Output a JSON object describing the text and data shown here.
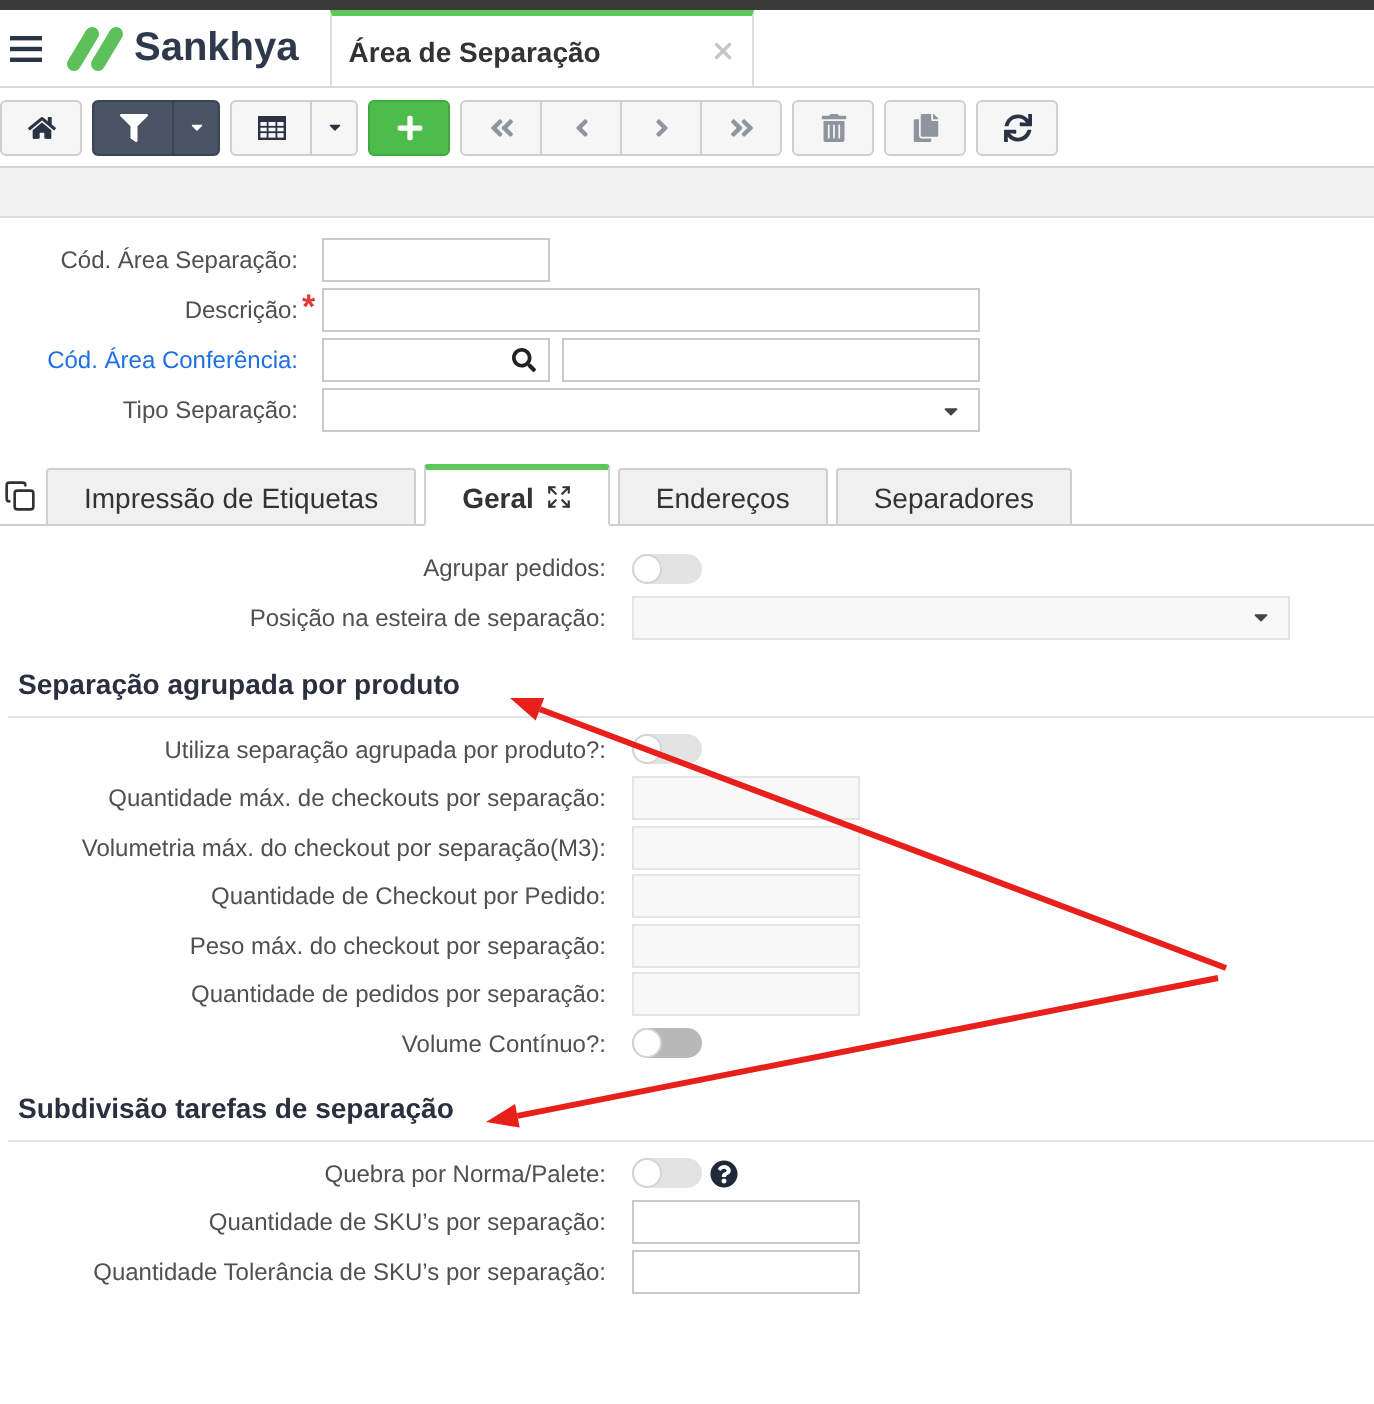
{
  "app": {
    "brand": "Sankhya"
  },
  "screen_tab": {
    "title": "Área de Separação"
  },
  "toolbar": [
    {
      "buttons": [
        {
          "kind": "home",
          "active": false,
          "disabled": false,
          "dropdown": false
        }
      ]
    },
    {
      "buttons": [
        {
          "kind": "filter",
          "active": true,
          "disabled": false,
          "dropdown": true
        }
      ]
    },
    {
      "buttons": [
        {
          "kind": "grid",
          "active": false,
          "disabled": false,
          "dropdown": true
        }
      ]
    },
    {
      "buttons": [
        {
          "kind": "add",
          "active": false,
          "disabled": false,
          "dropdown": false
        }
      ]
    },
    {
      "buttons": [
        {
          "kind": "first",
          "active": false,
          "disabled": true,
          "dropdown": false
        },
        {
          "kind": "previous",
          "active": false,
          "disabled": true,
          "dropdown": false
        },
        {
          "kind": "next",
          "active": false,
          "disabled": true,
          "dropdown": false
        },
        {
          "kind": "last",
          "active": false,
          "disabled": true,
          "dropdown": false
        }
      ]
    },
    {
      "buttons": [
        {
          "kind": "delete",
          "active": false,
          "disabled": true,
          "dropdown": false
        }
      ]
    },
    {
      "buttons": [
        {
          "kind": "duplicate",
          "active": false,
          "disabled": true,
          "dropdown": false
        }
      ]
    },
    {
      "buttons": [
        {
          "kind": "refresh",
          "active": false,
          "disabled": false,
          "dropdown": false
        }
      ]
    }
  ],
  "header_form": [
    {
      "kind": "code",
      "label": "Cód. Área Separação:"
    },
    {
      "kind": "text",
      "label": "Descrição:",
      "required_mark": "*"
    },
    {
      "kind": "lookup",
      "label": "Cód. Área Conferência:"
    },
    {
      "kind": "select",
      "label": "Tipo Separação:"
    }
  ],
  "tabs": [
    {
      "label": "Impressão de Etiquetas",
      "selected": false
    },
    {
      "label": "Geral",
      "selected": true
    },
    {
      "label": "Endereços",
      "selected": false
    },
    {
      "label": "Separadores",
      "selected": false
    }
  ],
  "general_fields": [
    {
      "kind": "toggle",
      "label": "Agrupar pedidos:",
      "on": false,
      "disabled": true,
      "help": false
    },
    {
      "kind": "select",
      "label": "Posição na esteira de separação:",
      "disabled": true,
      "help": false
    }
  ],
  "sections": [
    {
      "title": "Separação agrupada por produto",
      "annotated": true,
      "fields": [
        {
          "kind": "toggle",
          "label": "Utiliza separação agrupada por produto?:",
          "on": false,
          "disabled": true,
          "help": false
        },
        {
          "kind": "number",
          "label": "Quantidade máx. de checkouts por separação:",
          "disabled": true,
          "help": false
        },
        {
          "kind": "number",
          "label": "Volumetria máx. do checkout por separação(M3):",
          "disabled": true,
          "help": false
        },
        {
          "kind": "number",
          "label": "Quantidade de Checkout por Pedido:",
          "disabled": true,
          "help": false
        },
        {
          "kind": "number",
          "label": "Peso máx. do checkout por separação:",
          "disabled": true,
          "help": false
        },
        {
          "kind": "number",
          "label": "Quantidade de pedidos por separação:",
          "disabled": true,
          "help": false
        },
        {
          "kind": "toggle",
          "label": "Volume Contínuo?:",
          "on": false,
          "disabled": false,
          "help": false
        }
      ]
    },
    {
      "title": "Subdivisão tarefas de separação",
      "annotated": true,
      "fields": [
        {
          "kind": "toggle",
          "label": "Quebra por Norma/Palete:",
          "on": false,
          "disabled": true,
          "help": true
        },
        {
          "kind": "number",
          "label": "Quantidade de SKU’s por separação:",
          "disabled": false,
          "help": false
        },
        {
          "kind": "number",
          "label": "Quantidade Tolerância de SKU’s por separação:",
          "disabled": false,
          "help": false
        }
      ]
    }
  ]
}
